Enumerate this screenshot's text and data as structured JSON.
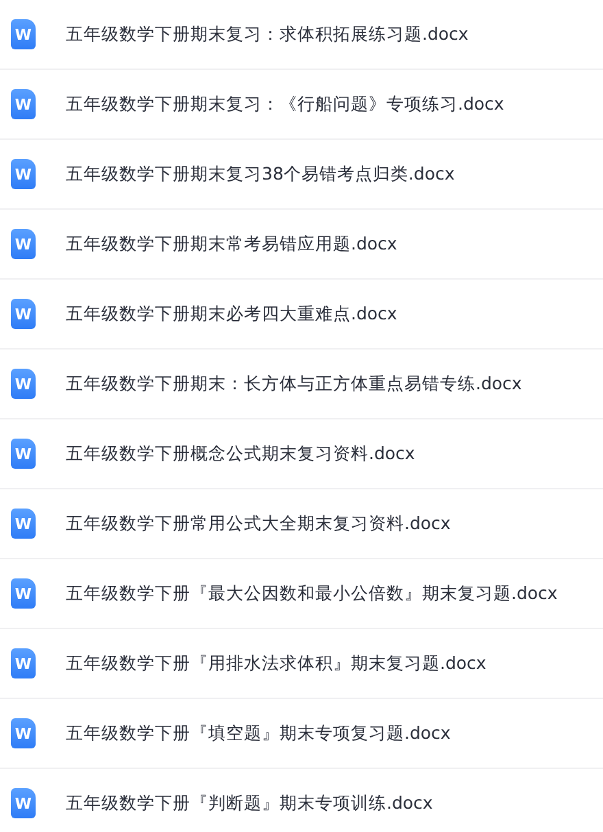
{
  "files": [
    {
      "icon_label": "W",
      "name": "五年级数学下册期末复习：求体积拓展练习题.docx"
    },
    {
      "icon_label": "W",
      "name": "五年级数学下册期末复习：《行船问题》专项练习.docx"
    },
    {
      "icon_label": "W",
      "name": "五年级数学下册期末复习38个易错考点归类.docx"
    },
    {
      "icon_label": "W",
      "name": "五年级数学下册期末常考易错应用题.docx"
    },
    {
      "icon_label": "W",
      "name": "五年级数学下册期末必考四大重难点.docx"
    },
    {
      "icon_label": "W",
      "name": "五年级数学下册期末：长方体与正方体重点易错专练.docx"
    },
    {
      "icon_label": "W",
      "name": "五年级数学下册概念公式期末复习资料.docx"
    },
    {
      "icon_label": "W",
      "name": "五年级数学下册常用公式大全期末复习资料.docx"
    },
    {
      "icon_label": "W",
      "name": "五年级数学下册『最大公因数和最小公倍数』期末复习题.docx"
    },
    {
      "icon_label": "W",
      "name": "五年级数学下册『用排水法求体积』期末复习题.docx"
    },
    {
      "icon_label": "W",
      "name": "五年级数学下册『填空题』期末专项复习题.docx"
    },
    {
      "icon_label": "W",
      "name": "五年级数学下册『判断题』期末专项训练.docx"
    }
  ]
}
